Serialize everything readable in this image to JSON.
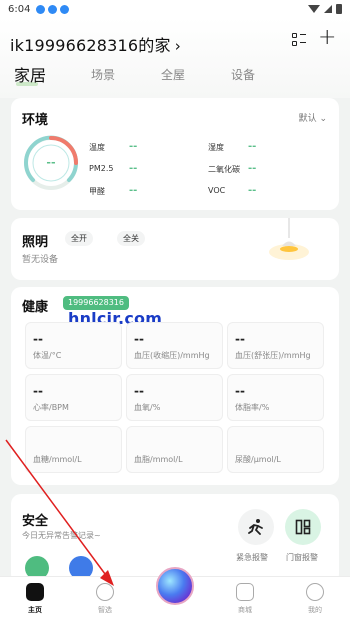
{
  "status_bar": {
    "time": "6:04"
  },
  "header": {
    "home_name": "ik19996628316的家",
    "chevron": "›",
    "add_glyph": "+"
  },
  "tabs": [
    {
      "label": "家居",
      "active": true
    },
    {
      "label": "场景",
      "active": false
    },
    {
      "label": "全屋",
      "active": false
    },
    {
      "label": "设备",
      "active": false
    }
  ],
  "environment": {
    "title": "环境",
    "default_label": "默认",
    "gauge_value": "--",
    "items": [
      {
        "label": "温度",
        "value": "--"
      },
      {
        "label": "湿度",
        "value": "--"
      },
      {
        "label": "PM2.5",
        "value": "--"
      },
      {
        "label": "二氧化碳",
        "value": "--"
      },
      {
        "label": "甲醛",
        "value": "--"
      },
      {
        "label": "VOC",
        "value": "--"
      }
    ]
  },
  "lighting": {
    "title": "照明",
    "all_on": "全开",
    "all_off": "全关",
    "no_device": "暂无设备"
  },
  "health": {
    "title": "健康",
    "user_badge": "19996628316",
    "watermark": "hnlcjr.com",
    "metrics": [
      {
        "value": "--",
        "label": "体温/°C"
      },
      {
        "value": "--",
        "label": "血压(收缩压)/mmHg"
      },
      {
        "value": "--",
        "label": "血压(舒张压)/mmHg"
      },
      {
        "value": "--",
        "label": "心率/BPM"
      },
      {
        "value": "--",
        "label": "血氧/%"
      },
      {
        "value": "--",
        "label": "体脂率/%"
      },
      {
        "value": "",
        "label": "血糖/mmol/L"
      },
      {
        "value": "",
        "label": "血脂/mmol/L"
      },
      {
        "value": "",
        "label": "尿酸/μmol/L"
      }
    ]
  },
  "security": {
    "title": "安全",
    "subtitle": "今日无异常告警记录~",
    "buttons": [
      {
        "label": "紧急报警"
      },
      {
        "label": "门窗报警"
      }
    ]
  },
  "bottom_nav": [
    {
      "label": "主页",
      "active": true
    },
    {
      "label": "智选",
      "active": false
    },
    {
      "label": "商城",
      "active": false
    },
    {
      "label": "我的",
      "active": false
    }
  ],
  "colors": {
    "accent_green": "#4fbc80",
    "value_green": "#5bbf8a",
    "watermark_blue": "#1a3cc6",
    "annotation_red": "#e02020"
  }
}
